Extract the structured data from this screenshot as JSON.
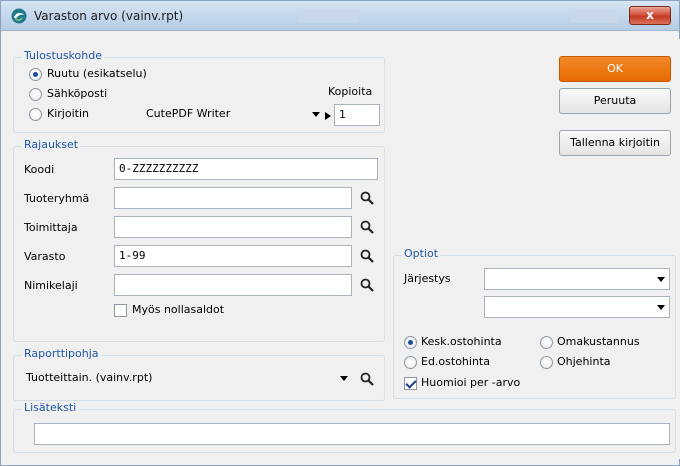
{
  "window": {
    "title": "Varaston arvo (vainv.rpt)",
    "close_label": "x"
  },
  "tulostuskohde": {
    "title": "Tulostuskohde",
    "options": [
      "Ruutu (esikatselu)",
      "Sähköposti",
      "Kirjoitin"
    ],
    "selected": "Ruutu (esikatselu)",
    "printer": "CutePDF Writer",
    "copies_label": "Kopioita",
    "copies_value": "1"
  },
  "rajaukset": {
    "title": "Rajaukset",
    "fields": [
      {
        "label": "Koodi",
        "value": "0-ZZZZZZZZZZ"
      },
      {
        "label": "Tuoteryhmä",
        "value": ""
      },
      {
        "label": "Toimittaja",
        "value": ""
      },
      {
        "label": "Varasto",
        "value": "1-99"
      },
      {
        "label": "Nimikelaji",
        "value": ""
      }
    ],
    "zero_balance_label": "Myös nollasaldot",
    "zero_balance_checked": false
  },
  "raporttipohja": {
    "title": "Raporttipohja",
    "value": "Tuotteittain. (vainv.rpt)"
  },
  "buttons": {
    "ok": "OK",
    "cancel": "Peruuta",
    "save_printer": "Tallenna kirjoitin"
  },
  "optiot": {
    "title": "Optiot",
    "sort_label": "Järjestys",
    "sort_value_1": "",
    "sort_value_2": "",
    "price_options": [
      "Kesk.ostohinta",
      "Omakustannus",
      "Ed.ostohinta",
      "Ohjehinta"
    ],
    "price_selected": "Kesk.ostohinta",
    "per_value_label": "Huomioi per -arvo",
    "per_value_checked": true
  },
  "lisateksti": {
    "title": "Lisäteksti",
    "value": ""
  },
  "colors": {
    "accent_orange": "#e76a00",
    "group_title_blue": "#1f55a8",
    "close_red": "#c43b23"
  }
}
